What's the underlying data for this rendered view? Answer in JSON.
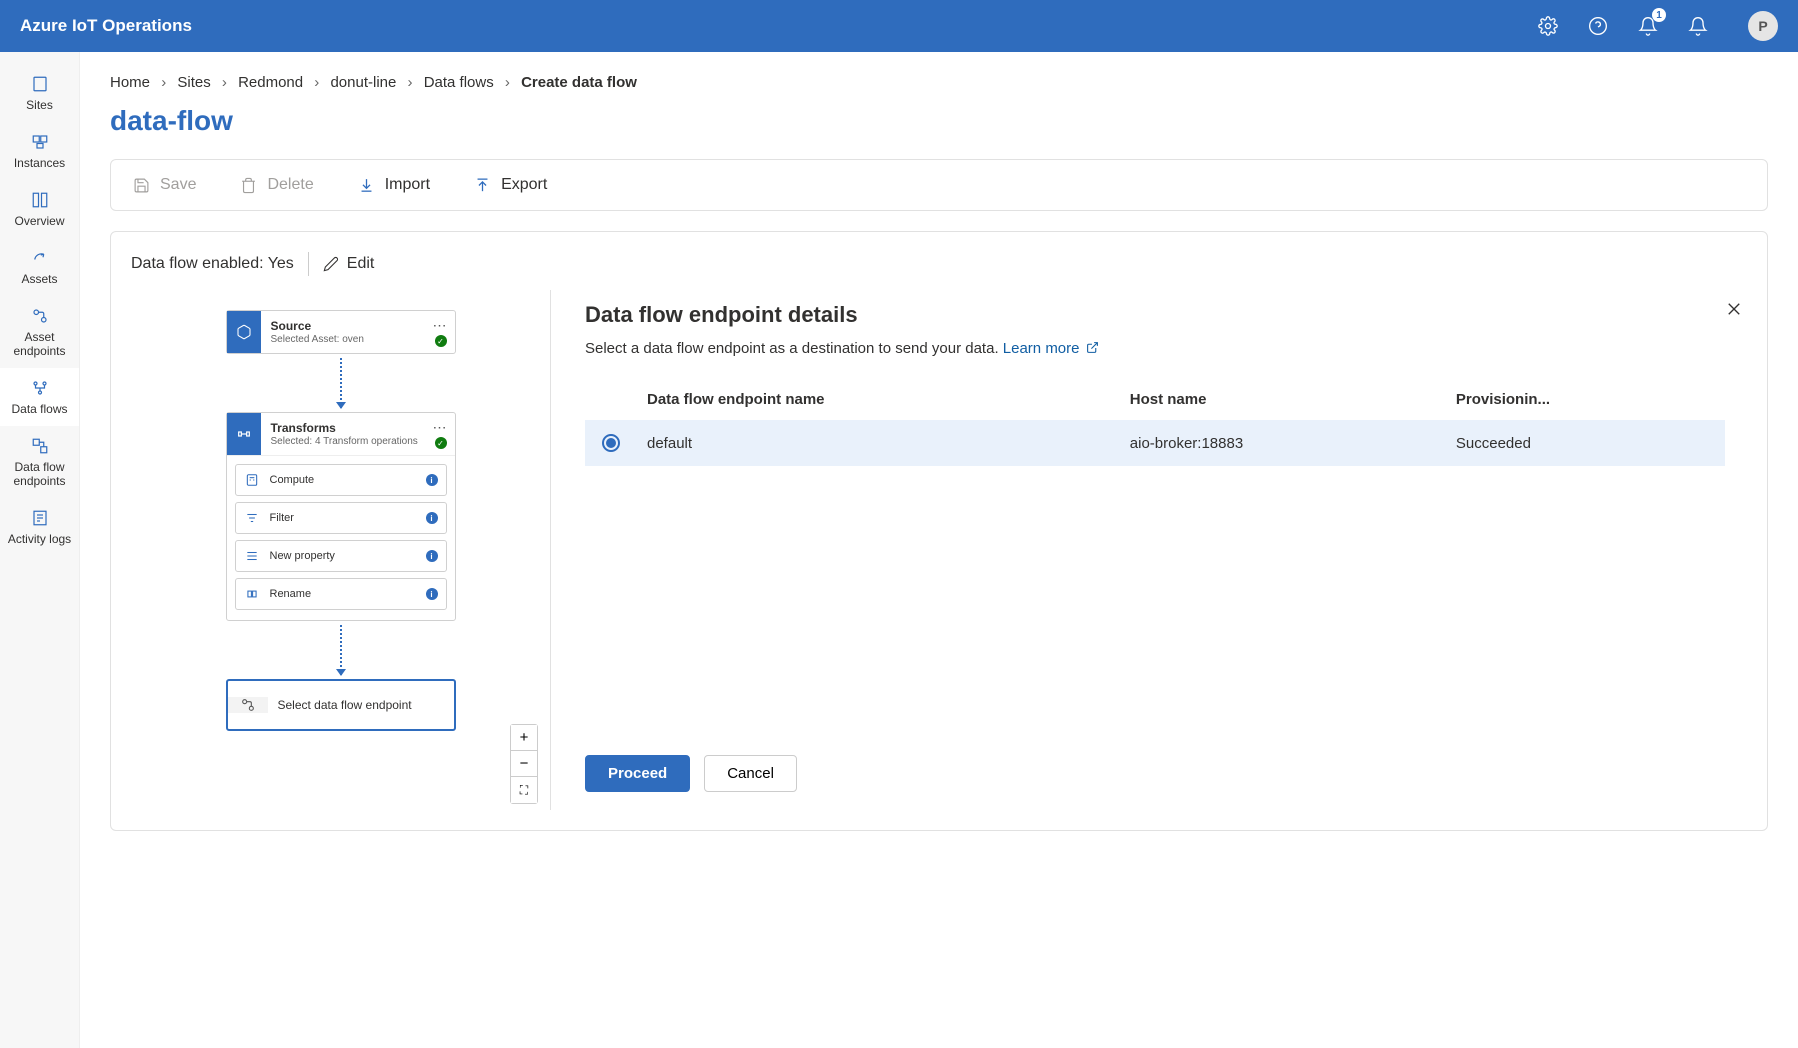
{
  "header": {
    "title": "Azure IoT Operations",
    "notification_count": "1",
    "avatar_letter": "P"
  },
  "sidebar": {
    "items": [
      {
        "label": "Sites"
      },
      {
        "label": "Instances"
      },
      {
        "label": "Overview"
      },
      {
        "label": "Assets"
      },
      {
        "label": "Asset endpoints"
      },
      {
        "label": "Data flows"
      },
      {
        "label": "Data flow endpoints"
      },
      {
        "label": "Activity logs"
      }
    ]
  },
  "breadcrumb": {
    "home": "Home",
    "sites": "Sites",
    "redmond": "Redmond",
    "instance": "donut-line",
    "dataflows": "Data flows",
    "current": "Create data flow"
  },
  "page_title": "data-flow",
  "toolbar": {
    "save": "Save",
    "delete": "Delete",
    "import": "Import",
    "export": "Export"
  },
  "status": {
    "enabled_label": "Data flow enabled: Yes",
    "edit": "Edit"
  },
  "nodes": {
    "source": {
      "title": "Source",
      "subtitle": "Selected Asset: oven"
    },
    "transforms": {
      "title": "Transforms",
      "subtitle": "Selected: 4 Transform operations"
    },
    "ops": {
      "compute": "Compute",
      "filter": "Filter",
      "newprop": "New property",
      "rename": "Rename"
    },
    "select": "Select data flow endpoint"
  },
  "panel": {
    "title": "Data flow endpoint details",
    "desc_pre": "Select a data flow endpoint as a destination to send your data. ",
    "learn_more": "Learn more",
    "columns": {
      "name": "Data flow endpoint name",
      "host": "Host name",
      "prov": "Provisionin..."
    },
    "rows": [
      {
        "name": "default",
        "host": "aio-broker:18883",
        "prov": "Succeeded"
      }
    ],
    "proceed": "Proceed",
    "cancel": "Cancel"
  }
}
